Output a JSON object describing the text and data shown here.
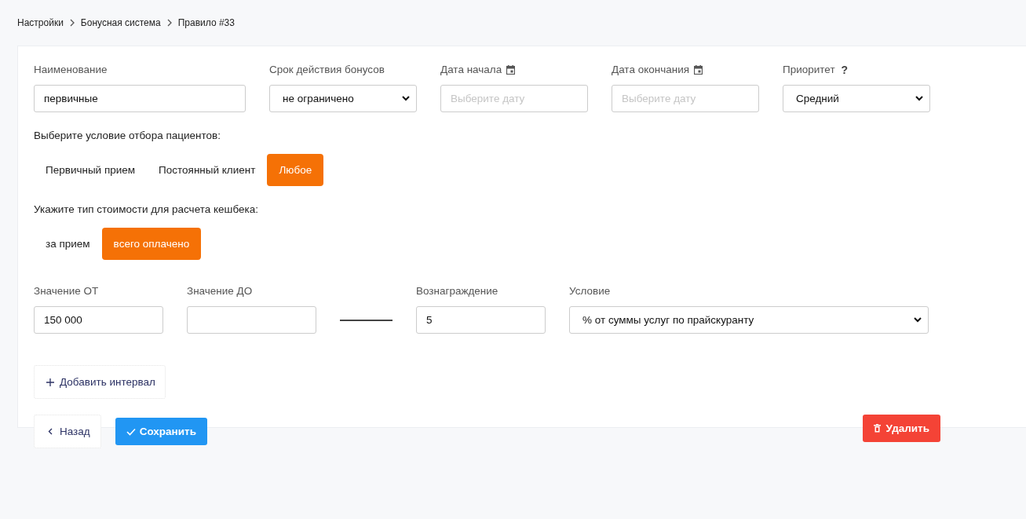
{
  "breadcrumbs": [
    {
      "label": "Настройки"
    },
    {
      "label": "Бонусная система"
    },
    {
      "label": "Правило #33"
    }
  ],
  "main_fields": [
    {
      "kind": "text",
      "label": "Наименование",
      "value": "первичные"
    },
    {
      "kind": "select",
      "label": "Срок действия бонусов",
      "value": "не ограничено"
    },
    {
      "kind": "date",
      "label": "Дата начала",
      "placeholder": "Выберите дату"
    },
    {
      "kind": "date",
      "label": "Дата окончания",
      "placeholder": "Выберите дату"
    },
    {
      "kind": "select",
      "label": "Приоритет",
      "help": "?",
      "value": "Средний"
    }
  ],
  "patient_condition": {
    "label": "Выберите условие отбора пациентов:",
    "options": [
      {
        "label": "Первичный прием",
        "selected": false
      },
      {
        "label": "Постоянный клиент",
        "selected": false
      },
      {
        "label": "Любое",
        "selected": true
      }
    ]
  },
  "cost_type": {
    "label": "Укажите тип стоимости для расчета кешбека:",
    "options": [
      {
        "label": "за прием",
        "selected": false
      },
      {
        "label": "всего оплачено",
        "selected": true
      }
    ]
  },
  "interval_fields": [
    {
      "kind": "text",
      "label": "Значение ОТ",
      "value": "150 000"
    },
    {
      "kind": "text",
      "label": "Значение ДО"
    },
    {
      "kind": "dash"
    },
    {
      "kind": "text",
      "label": "Вознаграждение",
      "value": "5"
    },
    {
      "kind": "select",
      "label": "Условие",
      "value": "% от суммы услуг по прайскуранту"
    }
  ],
  "add_interval_button": "Добавить интервал",
  "back_button": "Назад",
  "save_button": "Сохранить",
  "delete_button": "Удалить"
}
